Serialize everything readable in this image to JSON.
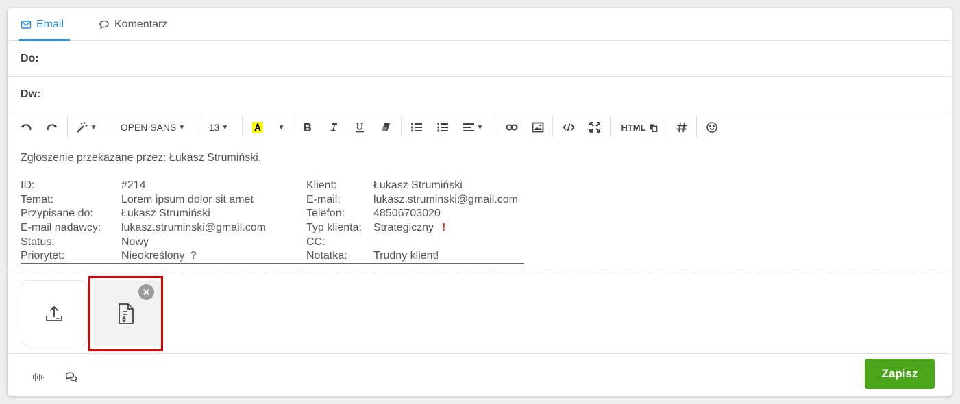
{
  "tabs": [
    {
      "label": "Email",
      "icon": "envelope-icon",
      "active": true
    },
    {
      "label": "Komentarz",
      "icon": "chat-bubble-icon",
      "active": false
    }
  ],
  "fields": {
    "to_label": "Do:",
    "cc_label": "Dw:"
  },
  "toolbar": {
    "font_name": "OPEN SANS",
    "font_size": "13",
    "html_label": "HTML",
    "highlight_color": "#ffff00"
  },
  "editor": {
    "intro": "Zgłoszenie przekazane przez: Łukasz Strumiński.",
    "rows": [
      {
        "k1": "ID:",
        "v1": "#214",
        "k2": "Klient:",
        "v2": "Łukasz Strumiński"
      },
      {
        "k1": "Temat:",
        "v1": "Lorem ipsum dolor sit amet",
        "k2": "E-mail:",
        "v2": "lukasz.struminski@gmail.com"
      },
      {
        "k1": "Przypisane do:",
        "v1": "Łukasz Strumiński",
        "k2": "Telefon:",
        "v2": "48506703020"
      },
      {
        "k1": "E-mail nadawcy:",
        "v1": "lukasz.struminski@gmail.com",
        "k2": "Typ klienta:",
        "v2": "Strategiczny"
      },
      {
        "k1": "Status:",
        "v1": "Nowy",
        "k2": "CC:",
        "v2": ""
      },
      {
        "k1": "Priorytet:",
        "v1": "Nieokreślony",
        "k2": "Notatka:",
        "v2": "Trudny klient!"
      }
    ],
    "priority_mark": "?",
    "strategic_mark": "!"
  },
  "save_label": "Zapisz",
  "colors": {
    "accent": "#2a8fd6",
    "save": "#4aa51a",
    "highlight": "#e00000"
  }
}
